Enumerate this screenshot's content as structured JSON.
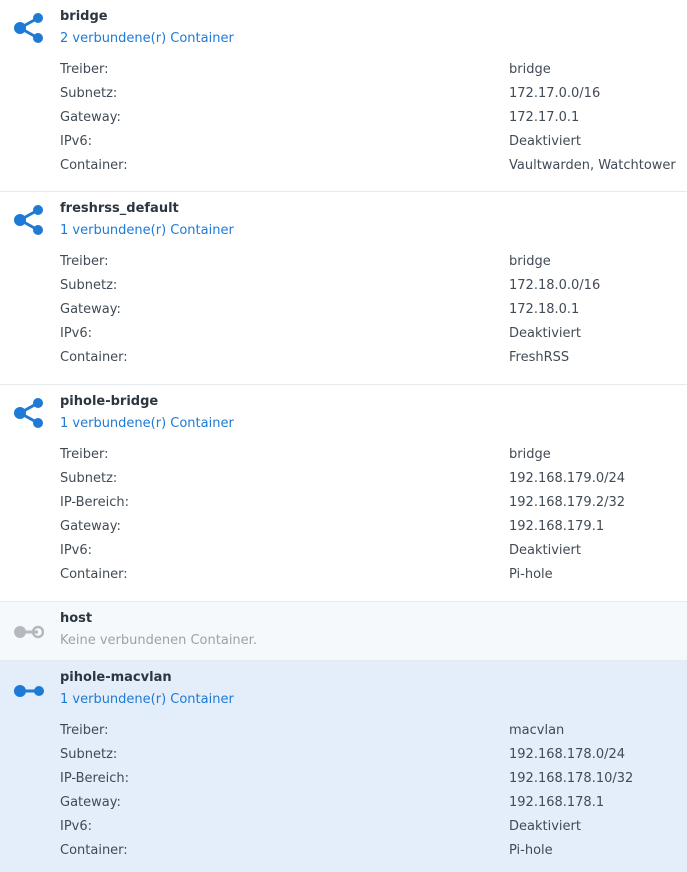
{
  "colors": {
    "accent": "#1f7ad6",
    "icon_disabled": "#b3b9bf",
    "selected_bg": "#e3eefa",
    "hover_bg": "#f5f9fc"
  },
  "networks": [
    {
      "name": "bridge",
      "icon": "share-network-icon",
      "connected": "2 verbundene(r) Container",
      "props": [
        {
          "k": "Treiber:",
          "v": "bridge"
        },
        {
          "k": "Subnetz:",
          "v": "172.17.0.0/16"
        },
        {
          "k": "Gateway:",
          "v": "172.17.0.1"
        },
        {
          "k": "IPv6:",
          "v": "Deaktiviert"
        },
        {
          "k": "Container:",
          "v": "Vaultwarden, Watchtower"
        }
      ]
    },
    {
      "name": "freshrss_default",
      "icon": "share-network-icon",
      "connected": "1 verbundene(r) Container",
      "props": [
        {
          "k": "Treiber:",
          "v": "bridge"
        },
        {
          "k": "Subnetz:",
          "v": "172.18.0.0/16"
        },
        {
          "k": "Gateway:",
          "v": "172.18.0.1"
        },
        {
          "k": "IPv6:",
          "v": "Deaktiviert"
        },
        {
          "k": "Container:",
          "v": "FreshRSS"
        }
      ]
    },
    {
      "name": "pihole-bridge",
      "icon": "share-network-icon",
      "connected": "1 verbundene(r) Container",
      "props": [
        {
          "k": "Treiber:",
          "v": "bridge"
        },
        {
          "k": "Subnetz:",
          "v": "192.168.179.0/24"
        },
        {
          "k": "IP-Bereich:",
          "v": "192.168.179.2/32"
        },
        {
          "k": "Gateway:",
          "v": "192.168.179.1"
        },
        {
          "k": "IPv6:",
          "v": "Deaktiviert"
        },
        {
          "k": "Container:",
          "v": "Pi-hole"
        }
      ]
    },
    {
      "name": "host",
      "icon": "host-link-icon",
      "connected": "Keine verbundenen Container.",
      "props": []
    },
    {
      "name": "pihole-macvlan",
      "icon": "macvlan-link-icon",
      "connected": "1 verbundene(r) Container",
      "props": [
        {
          "k": "Treiber:",
          "v": "macvlan"
        },
        {
          "k": "Subnetz:",
          "v": "192.168.178.0/24"
        },
        {
          "k": "IP-Bereich:",
          "v": "192.168.178.10/32"
        },
        {
          "k": "Gateway:",
          "v": "192.168.178.1"
        },
        {
          "k": "IPv6:",
          "v": "Deaktiviert"
        },
        {
          "k": "Container:",
          "v": "Pi-hole"
        }
      ]
    }
  ]
}
